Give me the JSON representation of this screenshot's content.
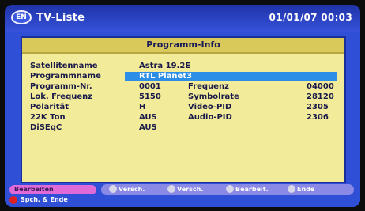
{
  "header": {
    "icon_label": "EN",
    "title": "TV-Liste",
    "datetime": "01/01/07  00:03"
  },
  "panel": {
    "title": "Programm-Info",
    "rows": [
      {
        "label": "Satellitenname",
        "value": "Astra 19.2E"
      },
      {
        "label": "Programmname",
        "value": "RTL Planet3",
        "highlighted": true
      },
      {
        "label": "Programm-Nr.",
        "value": "0001",
        "label2": "Frequenz",
        "value2": "04000"
      },
      {
        "label": "Lok. Frequenz",
        "value": "5150",
        "label2": "Symbolrate",
        "value2": "28120"
      },
      {
        "label": "Polarität",
        "value": "H",
        "label2": "Video-PID",
        "value2": "2305"
      },
      {
        "label": "22K Ton",
        "value": "AUS",
        "label2": "Audio-PID",
        "value2": "2306"
      },
      {
        "label": "DiSEqC",
        "value": "AUS"
      }
    ]
  },
  "footer": {
    "pink_label": "Bearbeiten",
    "items": [
      {
        "icon": "arrow-icon",
        "label": "Versch."
      },
      {
        "icon": "arrow-icon",
        "label": "Versch."
      },
      {
        "icon": "ok-icon",
        "label": "Bearbeit."
      },
      {
        "icon": "exit-icon",
        "label": "Ende"
      }
    ],
    "red_label": "Spch. & Ende"
  },
  "colors": {
    "background": "#2f4fd6",
    "panel": "#f2eb9a",
    "highlight": "#2c8ee6",
    "pink": "#e06ad8",
    "red": "#e02020"
  }
}
